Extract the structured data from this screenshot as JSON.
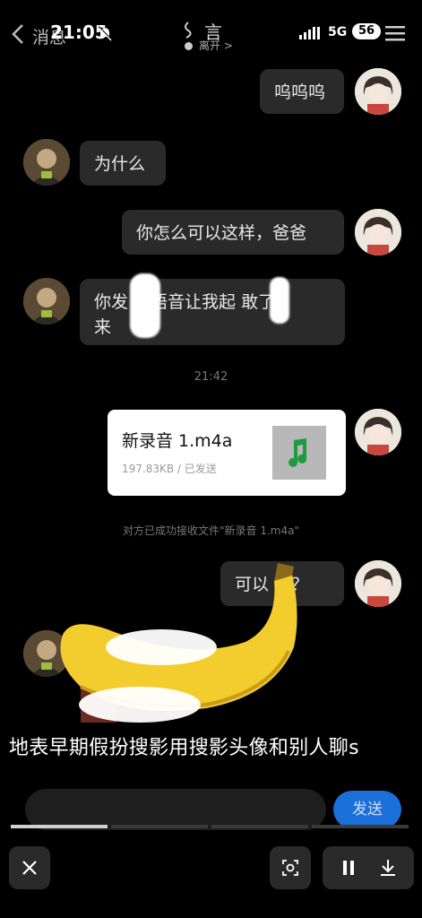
{
  "header": {
    "back_label": "消息",
    "time": "21:05",
    "contact_name": "言",
    "presence": "离开 >",
    "network": "5G",
    "battery": "56"
  },
  "messages": [
    {
      "side": "me",
      "text": "呜呜呜"
    },
    {
      "side": "other",
      "text": "为什么"
    },
    {
      "side": "me",
      "text": "你怎么可以这样，爸爸"
    },
    {
      "side": "other",
      "text_line1": "你发  的语音让我起  敢了",
      "text_line2": "来"
    },
    {
      "side": "me",
      "text": "可以 吗？"
    }
  ],
  "timestamp_separator": "21:42",
  "file_message": {
    "name": "新录音  1.m4a",
    "meta": "197.83KB / 已发送"
  },
  "file_notice": "对方已成功接收文件\"新录音  1.m4a\"",
  "caption": "地表早期假扮搜影用搜影头像和别人聊s",
  "composer": {
    "send_label": "发送"
  },
  "colors": {
    "background": "#000000",
    "bubble": "#2a2a2a",
    "send": "#1a6fd8",
    "banana": "#f2cd2d"
  }
}
